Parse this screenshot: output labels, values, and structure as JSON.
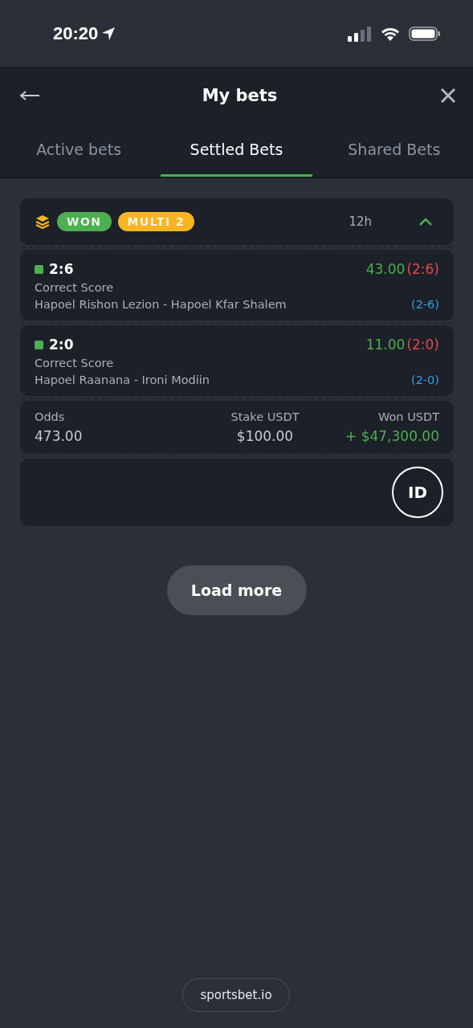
{
  "status_bar": {
    "time": "20:20"
  },
  "header": {
    "title": "My bets"
  },
  "tabs": [
    {
      "label": "Active bets",
      "selected": false
    },
    {
      "label": "Settled Bets",
      "selected": true
    },
    {
      "label": "Shared Bets",
      "selected": false
    }
  ],
  "bet": {
    "status": "WON",
    "type": "MULTI 2",
    "age": "12h",
    "expanded": true,
    "selections": [
      {
        "pick": "2:6",
        "color": "#4caf50",
        "market": "Correct Score",
        "event": "Hapoel Rishon Lezion - Hapoel Kfar Shalem",
        "odds": "43.00",
        "result": "(2:6)",
        "score": "(2-6)"
      },
      {
        "pick": "2:0",
        "color": "#4caf50",
        "market": "Correct Score",
        "event": "Hapoel Raanana - Ironi Modiin",
        "odds": "11.00",
        "result": "(2:0)",
        "score": "(2-0)"
      }
    ],
    "odds_label": "Odds",
    "odds": "473.00",
    "stake_label": "Stake USDT",
    "stake": "$100.00",
    "won_label": "Won USDT",
    "won": "+ $47,300.00",
    "id_button": "ID"
  },
  "load_more": "Load more",
  "footer": {
    "brand": "sportsbet.io"
  }
}
